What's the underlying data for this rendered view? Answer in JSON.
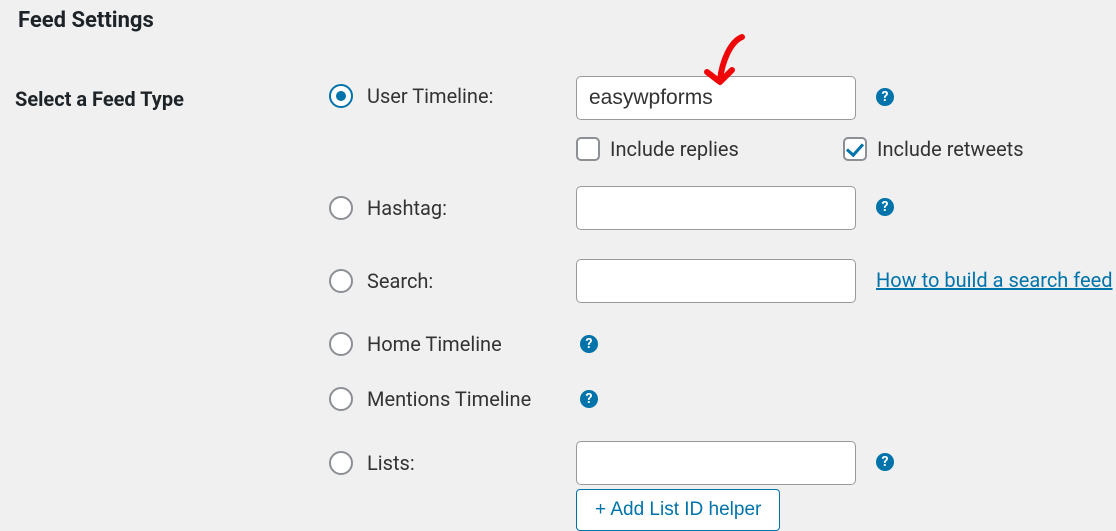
{
  "heading": "Feed Settings",
  "left_label": "Select a Feed Type",
  "options": {
    "user_timeline": {
      "label": "User Timeline:"
    },
    "hashtag": {
      "label": "Hashtag:"
    },
    "search": {
      "label": "Search:"
    },
    "home_timeline": {
      "label": "Home Timeline"
    },
    "mentions_timeline": {
      "label": "Mentions Timeline"
    },
    "lists": {
      "label": "Lists:"
    }
  },
  "inputs": {
    "user_timeline": "easywpforms",
    "hashtag": "",
    "search": "",
    "lists": ""
  },
  "checkboxes": {
    "include_replies": {
      "label": "Include replies",
      "checked": false
    },
    "include_retweets": {
      "label": "Include retweets",
      "checked": true
    }
  },
  "search_link": "How to build a search feed",
  "list_helper_button": "+ Add List ID helper",
  "help_glyph": "?"
}
